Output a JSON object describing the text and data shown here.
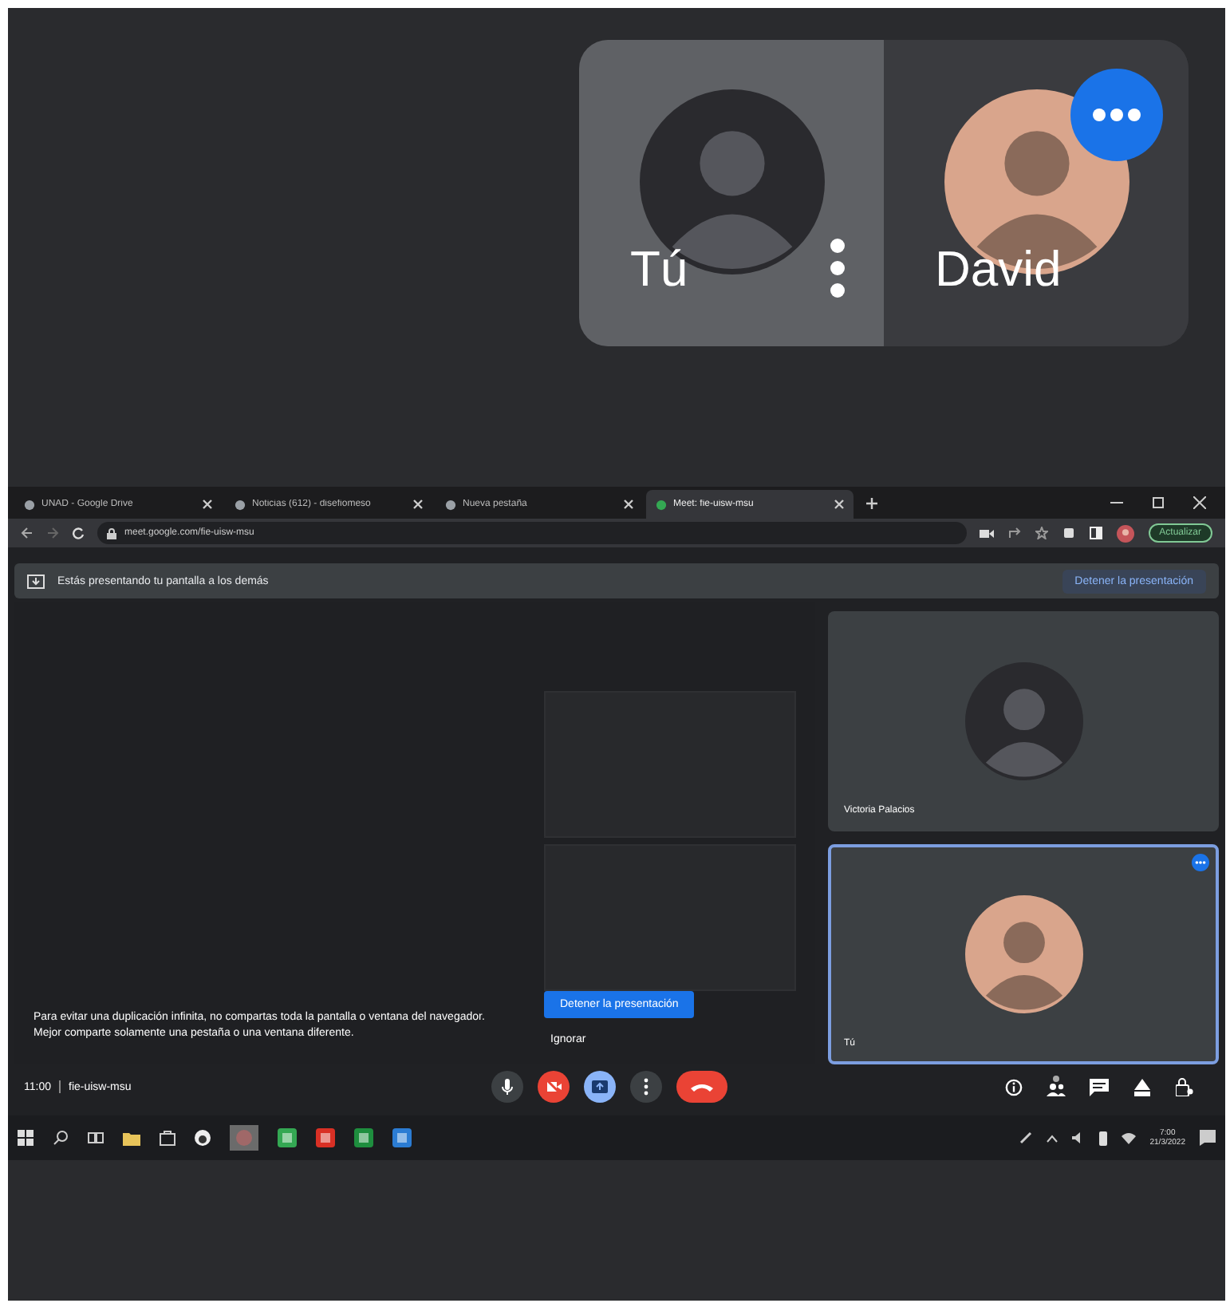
{
  "floating_panel": {
    "tiles": [
      {
        "name": "Tú",
        "highlighted": true,
        "kind": "self"
      },
      {
        "name": "David",
        "highlighted": false,
        "kind": "remote"
      }
    ]
  },
  "browser": {
    "tabs": [
      {
        "label": "UNAD - Google Drive",
        "selected": false
      },
      {
        "label": "Noticias (612) - disefiomeso",
        "selected": false
      },
      {
        "label": "Nueva pestaña",
        "selected": false
      },
      {
        "label": "Meet: fie-uisw-msu",
        "selected": true
      }
    ],
    "address": "meet.google.com/fie-uisw-msu",
    "profile_button": "Actualizar"
  },
  "banner": {
    "text": "Estás presentando tu pantalla a los demás",
    "button": "Detener la presentación"
  },
  "tiles": [
    {
      "name": "Victoria Palacios",
      "selected": false
    },
    {
      "name": "Tú",
      "selected": true
    }
  ],
  "warning": {
    "text": "Para evitar una duplicación infinita, no compartas toda la pantalla o ventana del navegador. Mejor comparte solamente una pestaña o una ventana diferente.",
    "button": "Detener la presentación",
    "dismiss": "Ignorar"
  },
  "meeting_bar": {
    "time": "11:00",
    "code": "fie-uisw-msu",
    "controls": [
      {
        "kind": "mic"
      },
      {
        "kind": "camera"
      },
      {
        "kind": "present"
      },
      {
        "kind": "more"
      },
      {
        "kind": "hangup"
      }
    ]
  },
  "taskbar": {
    "time": "7:00",
    "date": "21/3/2022"
  }
}
